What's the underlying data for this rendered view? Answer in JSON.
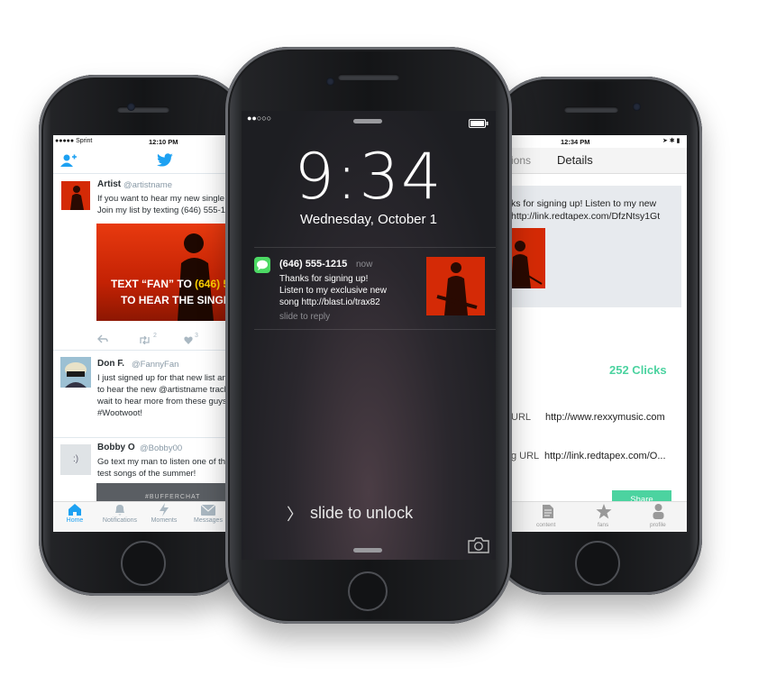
{
  "left_phone": {
    "status": {
      "carrier": "●●●●● Sprint",
      "time": "12:10 PM",
      "battery": "▮"
    },
    "tweets": [
      {
        "name": "Artist",
        "handle": "@artistname",
        "lines": [
          "If you want to hear my new single",
          "Join my list by texting (646) 555-12"
        ],
        "banner_line1_pre": "TEXT “FAN” TO ",
        "banner_phone": "(646) 555-",
        "banner_line2": "TO HEAR THE SINGLE FI",
        "retweets": "2",
        "likes": "3"
      },
      {
        "name": "Don F.",
        "handle": "@FannyFan",
        "lines": [
          "I just signed up for that new list an",
          "to hear the new @artistname track",
          "wait to hear more from these guys",
          "#Wootwoot!"
        ]
      },
      {
        "name": "Bobby O",
        "handle": "@Bobby00",
        "avatar_text": ":)",
        "lines": [
          "Go text my man to listen one of the",
          "test songs of the summer!"
        ],
        "media_text": "#BUFFERCHAT"
      }
    ],
    "tabs": [
      {
        "label": "Home",
        "icon": "home-icon"
      },
      {
        "label": "Notifications",
        "icon": "bell-icon"
      },
      {
        "label": "Moments",
        "icon": "lightning-icon"
      },
      {
        "label": "Messages",
        "icon": "envelope-icon"
      }
    ]
  },
  "center_phone": {
    "signal": "●●○○○",
    "time": "9:34",
    "date": "Wednesday, October 1",
    "notification": {
      "sender": "(646) 555-1215",
      "when": "now",
      "lines": [
        "Thanks for signing up!",
        "Listen to my exclusive new",
        "song http://blast.io/trax82"
      ],
      "action": "slide to reply"
    },
    "unlock_chevron": "〉",
    "unlock_text": "slide to unlock"
  },
  "right_phone": {
    "status": {
      "time": "12:34 PM",
      "icons": "➤ ✱ ▮"
    },
    "nav": {
      "back": "ions",
      "title": "Details"
    },
    "message_lines": [
      "ks for signing up! Listen to my new",
      "http://link.redtapex.com/DfzNtsy1Gt"
    ],
    "clicks": "252 Clicks",
    "rows": [
      {
        "label": "URL",
        "value": "http://www.rexxymusic.com"
      },
      {
        "label": "g URL",
        "value": "http://link.redtapex.com/O..."
      }
    ],
    "share": "Share",
    "tabs": [
      {
        "label": "content",
        "icon": "document-icon"
      },
      {
        "label": "fans",
        "icon": "star-icon"
      },
      {
        "label": "profile",
        "icon": "person-icon"
      }
    ],
    "accent": "#4cd3a0"
  },
  "colors": {
    "twitter_blue": "#1da1f2",
    "accent_green": "#4cd3a0",
    "artwork_red": "#d42a06"
  }
}
